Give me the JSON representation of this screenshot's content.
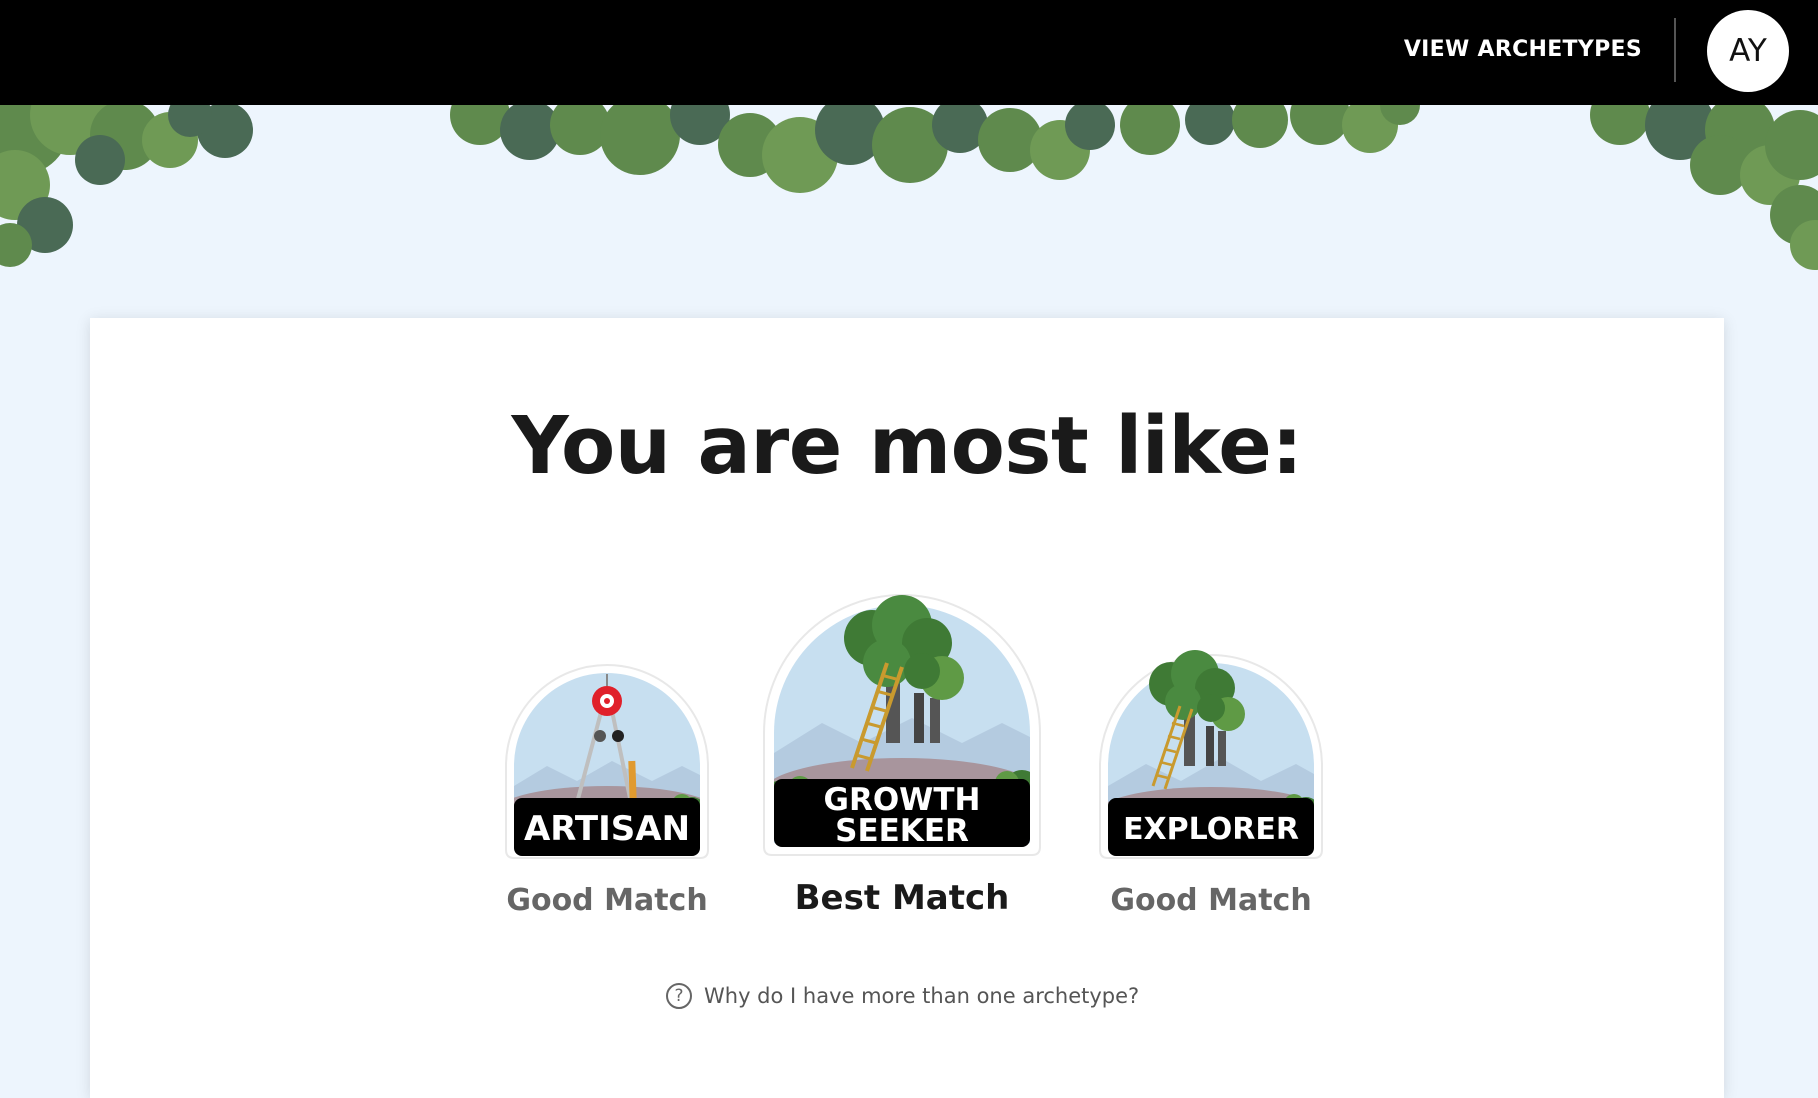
{
  "header": {
    "nav_link": "VIEW ARCHETYPES",
    "avatar_initials": "AY"
  },
  "main": {
    "heading": "You are most like:",
    "archetypes": [
      {
        "name": "ARTISAN",
        "match": "Good Match",
        "icon": "compass-icon"
      },
      {
        "name_line1": "GROWTH",
        "name_line2": "SEEKER",
        "match": "Best Match",
        "icon": "tree-ladder-icon"
      },
      {
        "name": "EXPLORER",
        "match": "Good Match",
        "icon": "tree-ladder-icon"
      }
    ],
    "help_link": "Why do I have more than one archetype?"
  },
  "colors": {
    "topbar": "#000000",
    "sky": "#edf5fd",
    "leaf_dark": "#4a6a55",
    "leaf_mid": "#5f8a4d",
    "leaf_light": "#6f9a55"
  }
}
